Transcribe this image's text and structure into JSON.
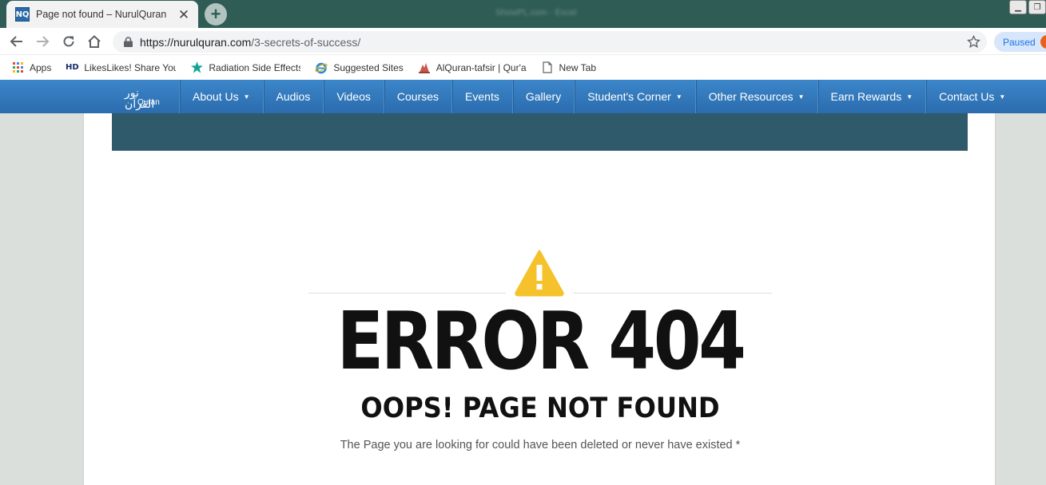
{
  "browser": {
    "tab": {
      "favicon_text": "NQ",
      "title": "Page not found – NurulQuran",
      "close_glyph": "✕"
    },
    "new_tab_glyph": "+",
    "window_title": "ShowPL.com - Excel",
    "window_controls": [
      "▁",
      "❐"
    ],
    "url": {
      "domain": "https://nurulquran.com",
      "path": "/3-secrets-of-success/"
    },
    "profile_status": "Paused",
    "bookmarks": [
      {
        "icon": "apps-grid-icon",
        "label": "Apps"
      },
      {
        "icon": "hd-icon",
        "icon_text": "HD",
        "label": "LikesLikes! Share You"
      },
      {
        "icon": "star-burst-icon",
        "label": "Radiation Side Effects"
      },
      {
        "icon": "ie-icon",
        "label": "Suggested Sites"
      },
      {
        "icon": "quran-icon",
        "label": "AlQuran-tafsir | Qur'a"
      },
      {
        "icon": "page-icon",
        "label": "New Tab"
      }
    ]
  },
  "site": {
    "logo_text_ar": "نور القرآن",
    "logo_text_en": "Quran",
    "menu": [
      {
        "label": "About Us",
        "dropdown": true
      },
      {
        "label": "Audios",
        "dropdown": false
      },
      {
        "label": "Videos",
        "dropdown": false
      },
      {
        "label": "Courses",
        "dropdown": false
      },
      {
        "label": "Events",
        "dropdown": false
      },
      {
        "label": "Gallery",
        "dropdown": false
      },
      {
        "label": "Student's Corner",
        "dropdown": true
      },
      {
        "label": "Other Resources",
        "dropdown": true
      },
      {
        "label": "Earn Rewards",
        "dropdown": true
      },
      {
        "label": "Contact Us",
        "dropdown": true
      }
    ],
    "caret_glyph": "▼"
  },
  "error": {
    "code": "ERROR 404",
    "title": "OOPS! PAGE NOT FOUND",
    "message": "The Page you are looking for could have been deleted or never have existed *"
  },
  "colors": {
    "tabstrip": "#2f5d55",
    "nav_blue": "#3179bd",
    "hero_band": "#2e5a6b",
    "warning_yellow": "#f5c22b"
  }
}
